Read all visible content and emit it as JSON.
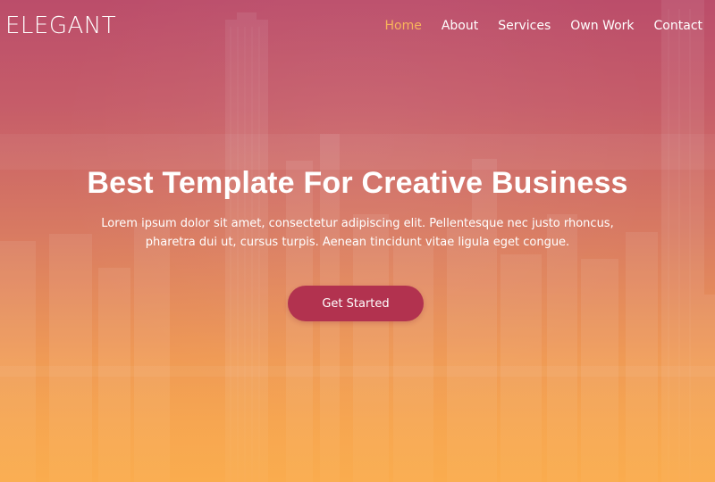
{
  "header": {
    "brand": "ELEGANT",
    "nav": [
      {
        "label": "Home",
        "active": true
      },
      {
        "label": "About",
        "active": false
      },
      {
        "label": "Services",
        "active": false
      },
      {
        "label": "Own Work",
        "active": false
      },
      {
        "label": "Contact",
        "active": false
      }
    ]
  },
  "hero": {
    "title": "Best Template For Creative Business",
    "text_line1": "Lorem ipsum dolor sit amet, consectetur adipiscing elit. Pellentesque nec justo rhoncus,",
    "text_line2": "pharetra dui ut, cursus turpis. Aenean tincidunt vitae ligula eget congue.",
    "cta_label": "Get Started",
    "background_image": "city-skyline"
  },
  "colors": {
    "gradient_top": "#bb4d6a",
    "gradient_bottom": "#f9ab4f",
    "nav_active": "#f8b45b",
    "cta_background": "#b2324f",
    "text": "#ffffff"
  }
}
